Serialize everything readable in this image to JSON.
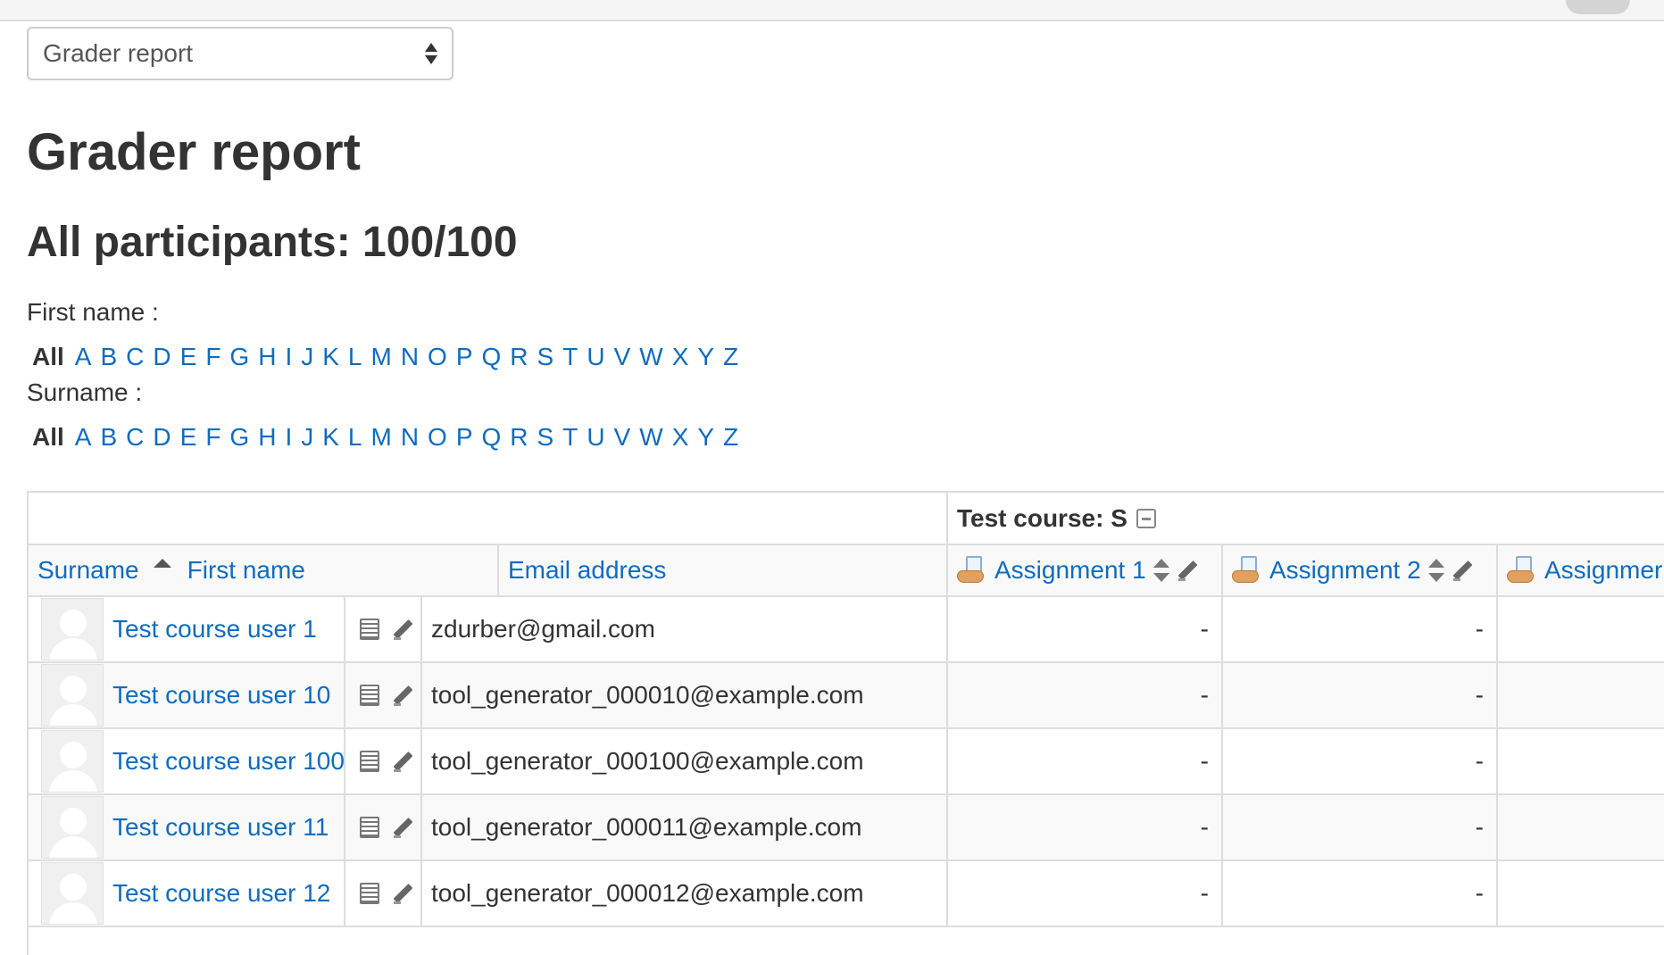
{
  "report_selector": {
    "value": "Grader report"
  },
  "page": {
    "title": "Grader report",
    "participants": "All participants: 100/100"
  },
  "filters": {
    "firstname_label": "First name :",
    "surname_label": "Surname :",
    "all_label": "All",
    "letters": [
      "A",
      "B",
      "C",
      "D",
      "E",
      "F",
      "G",
      "H",
      "I",
      "J",
      "K",
      "L",
      "M",
      "N",
      "O",
      "P",
      "Q",
      "R",
      "S",
      "T",
      "U",
      "V",
      "W",
      "X",
      "Y",
      "Z"
    ]
  },
  "table": {
    "course_category": "Test course: S",
    "headers": {
      "surname": "Surname",
      "firstname": "First name",
      "email": "Email address",
      "assignment1": "Assignment 1",
      "assignment2": "Assignment 2",
      "assignment3": "Assignmer"
    },
    "rows": [
      {
        "name": "Test course user 1",
        "email": "zdurber@gmail.com",
        "a1": "-",
        "a2": "-"
      },
      {
        "name": "Test course user 10",
        "email": "tool_generator_000010@example.com",
        "a1": "-",
        "a2": "-"
      },
      {
        "name": "Test course user 100",
        "email": "tool_generator_000100@example.com",
        "a1": "-",
        "a2": "-"
      },
      {
        "name": "Test course user 11",
        "email": "tool_generator_000011@example.com",
        "a1": "-",
        "a2": "-"
      },
      {
        "name": "Test course user 12",
        "email": "tool_generator_000012@example.com",
        "a1": "-",
        "a2": "-"
      }
    ]
  },
  "icons": {
    "assignment": "assignment-icon",
    "move": "move-icon",
    "edit": "pencil-icon",
    "report": "grid-icon",
    "collapse": "collapse-icon",
    "sort": "sort-ascending-icon"
  },
  "colors": {
    "link": "#0f6cbf",
    "text": "#333333",
    "border": "#dddddd",
    "header_bg": "#f9f9f9"
  }
}
